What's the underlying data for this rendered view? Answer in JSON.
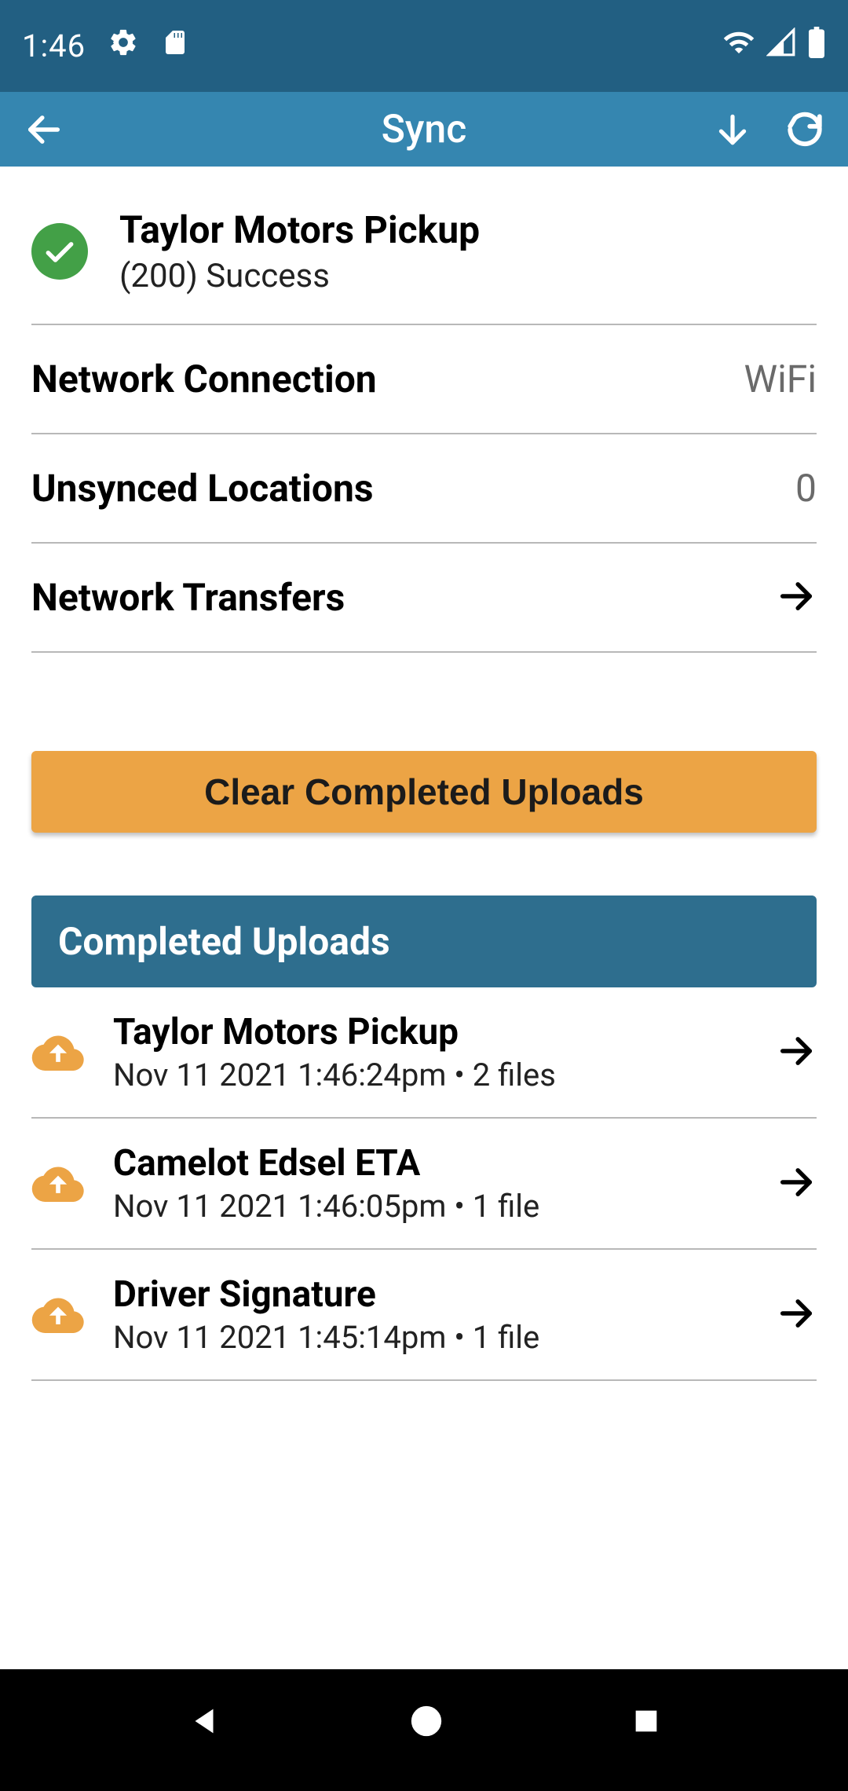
{
  "statusBar": {
    "time": "1:46"
  },
  "appBar": {
    "title": "Sync"
  },
  "syncStatus": {
    "title": "Taylor Motors Pickup",
    "subtitle": "(200) Success"
  },
  "info": {
    "networkConnection": {
      "label": "Network Connection",
      "value": "WiFi"
    },
    "unsyncedLocations": {
      "label": "Unsynced Locations",
      "value": "0"
    },
    "networkTransfers": {
      "label": "Network Transfers"
    }
  },
  "clearButton": "Clear Completed Uploads",
  "sectionHeader": "Completed Uploads",
  "uploads": [
    {
      "title": "Taylor Motors Pickup",
      "subtitle": "Nov 11 2021 1:46:24pm • 2 files"
    },
    {
      "title": "Camelot Edsel ETA",
      "subtitle": "Nov 11 2021 1:46:05pm • 1 file"
    },
    {
      "title": "Driver Signature",
      "subtitle": "Nov 11 2021 1:45:14pm • 1 file"
    }
  ]
}
